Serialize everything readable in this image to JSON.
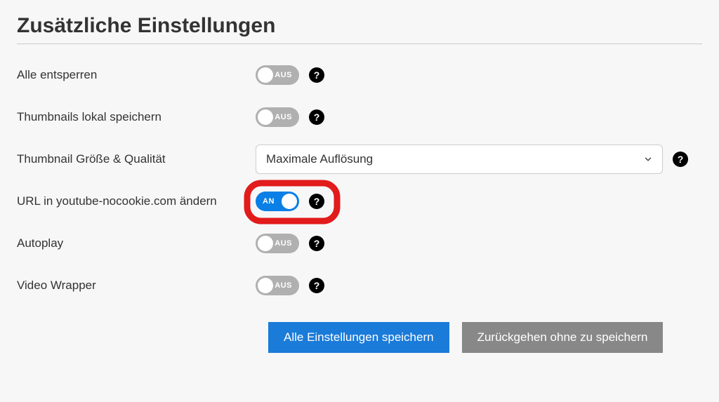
{
  "title": "Zusätzliche Einstellungen",
  "toggle_labels": {
    "on": "AN",
    "off": "AUS"
  },
  "rows": {
    "unlock_all": {
      "label": "Alle entsperren"
    },
    "thumb_local": {
      "label": "Thumbnails lokal speichern"
    },
    "thumb_size": {
      "label": "Thumbnail Größe & Qualität",
      "select_value": "Maximale Auflösung"
    },
    "nocookie": {
      "label": "URL in youtube-nocookie.com ändern"
    },
    "autoplay": {
      "label": "Autoplay"
    },
    "wrapper": {
      "label": "Video Wrapper"
    }
  },
  "buttons": {
    "save": "Alle Einstellungen speichern",
    "cancel": "Zurückgehen ohne zu speichern"
  },
  "help_glyph": "?"
}
